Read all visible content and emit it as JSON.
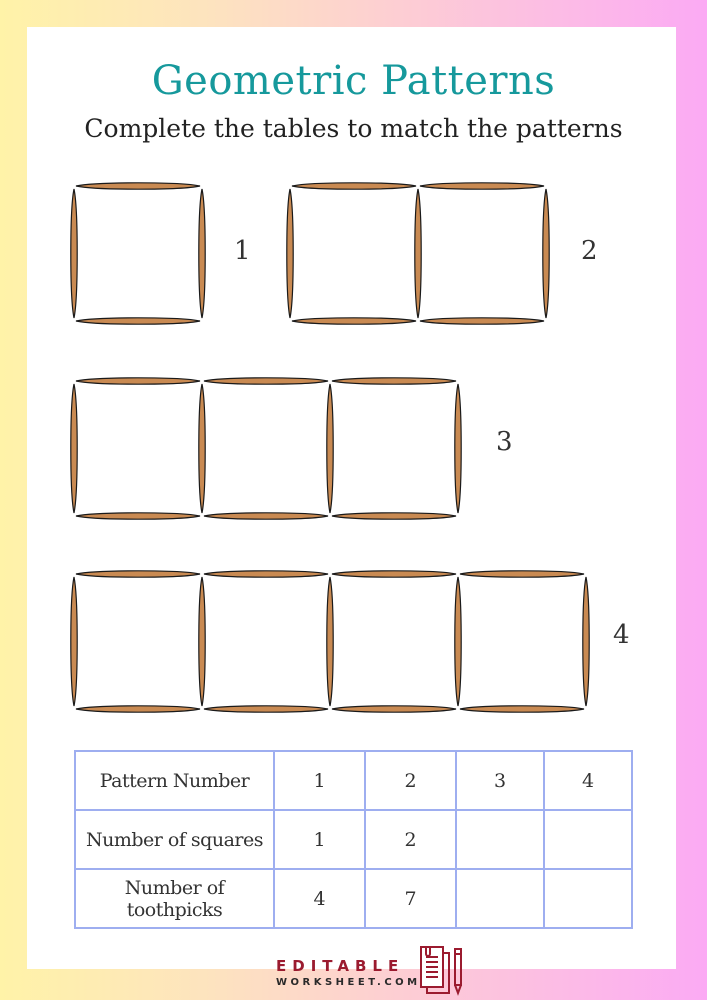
{
  "header": {
    "title": "Geometric Patterns",
    "subtitle": "Complete the tables to match the patterns"
  },
  "patterns": [
    {
      "label": "1",
      "squares": 1
    },
    {
      "label": "2",
      "squares": 2
    },
    {
      "label": "3",
      "squares": 3
    },
    {
      "label": "4",
      "squares": 4
    }
  ],
  "table": {
    "rows": [
      {
        "header": "Pattern Number",
        "cells": [
          "1",
          "2",
          "3",
          "4"
        ]
      },
      {
        "header": "Number of squares",
        "cells": [
          "1",
          "2",
          "",
          ""
        ]
      },
      {
        "header": "Number of toothpicks",
        "cells": [
          "4",
          "7",
          "",
          ""
        ]
      }
    ]
  },
  "footer": {
    "brand_line1": "EDITABLE",
    "brand_line2": "WORKSHEET.COM",
    "logo_icon": "document-pencil-icon"
  },
  "colors": {
    "title": "#16999c",
    "toothpick": "#c98a52",
    "table_border": "#9eaef0",
    "brand": "#9b1b2f"
  }
}
